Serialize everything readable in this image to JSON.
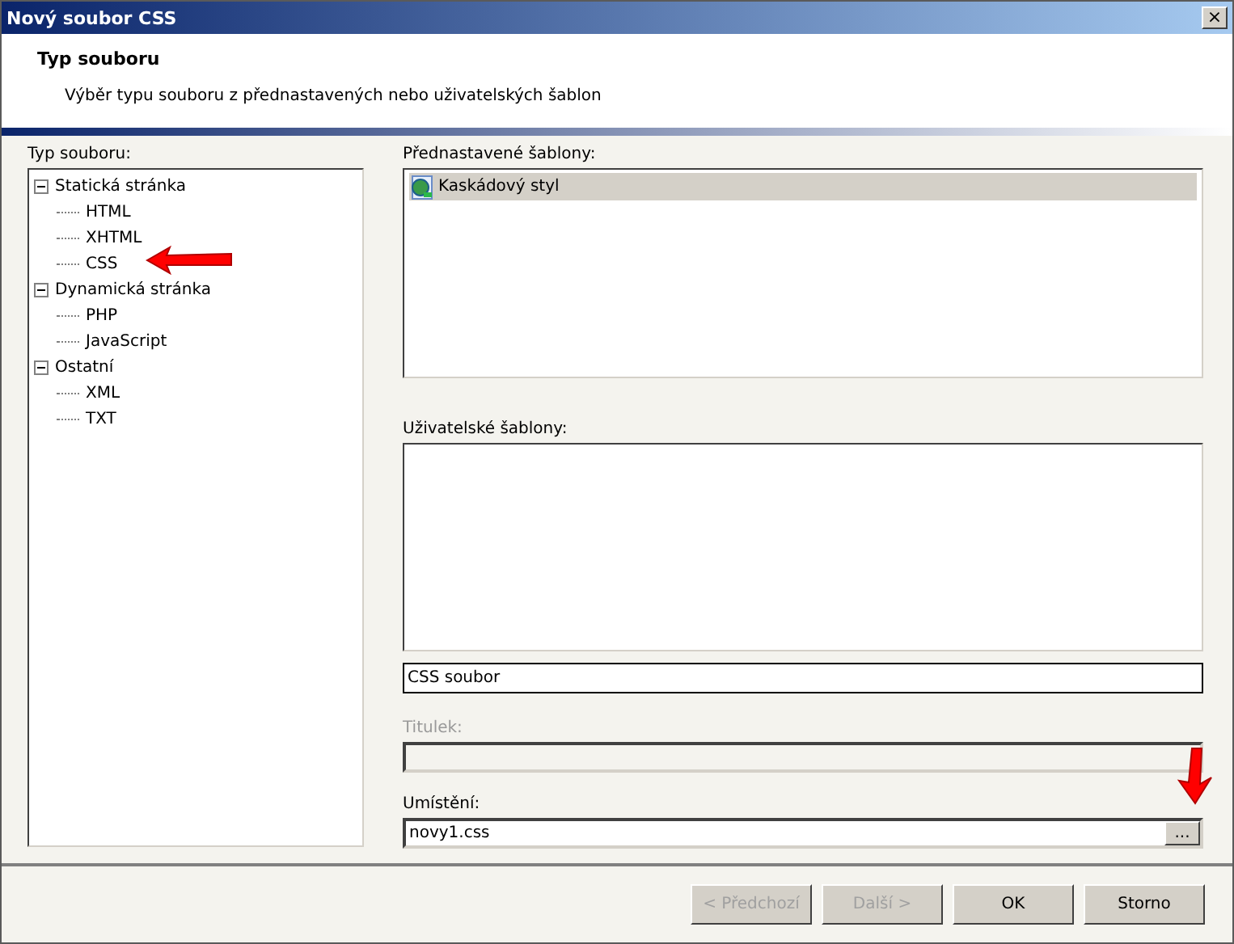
{
  "window": {
    "title": "Nový soubor CSS",
    "close": "×"
  },
  "header": {
    "title": "Typ souboru",
    "subtitle": "Výběr typu souboru z přednastavených nebo uživatelských šablon"
  },
  "tree": {
    "label": "Typ souboru:",
    "items": [
      {
        "label": "Statická stránka",
        "expanded": true,
        "children": [
          {
            "label": "HTML"
          },
          {
            "label": "XHTML"
          },
          {
            "label": "CSS"
          }
        ]
      },
      {
        "label": "Dynamická stránka",
        "expanded": true,
        "children": [
          {
            "label": "PHP"
          },
          {
            "label": "JavaScript"
          }
        ]
      },
      {
        "label": "Ostatní",
        "expanded": true,
        "children": [
          {
            "label": "XML"
          },
          {
            "label": "TXT"
          }
        ]
      }
    ]
  },
  "preset_templates": {
    "label": "Přednastavené šablony:",
    "items": [
      {
        "label": "Kaskádový styl",
        "selected": true
      }
    ]
  },
  "user_templates": {
    "label": "Uživatelské šablony:"
  },
  "description_field": {
    "value": "CSS soubor"
  },
  "title_field": {
    "label": "Titulek:",
    "disabled": true
  },
  "location_field": {
    "label": "Umístění:",
    "value": "novy1.css",
    "browse": "..."
  },
  "buttons": [
    {
      "label": "< Předchozí",
      "disabled": true
    },
    {
      "label": "Další >",
      "disabled": true
    },
    {
      "label": "OK",
      "disabled": false
    },
    {
      "label": "Storno",
      "disabled": false
    }
  ]
}
